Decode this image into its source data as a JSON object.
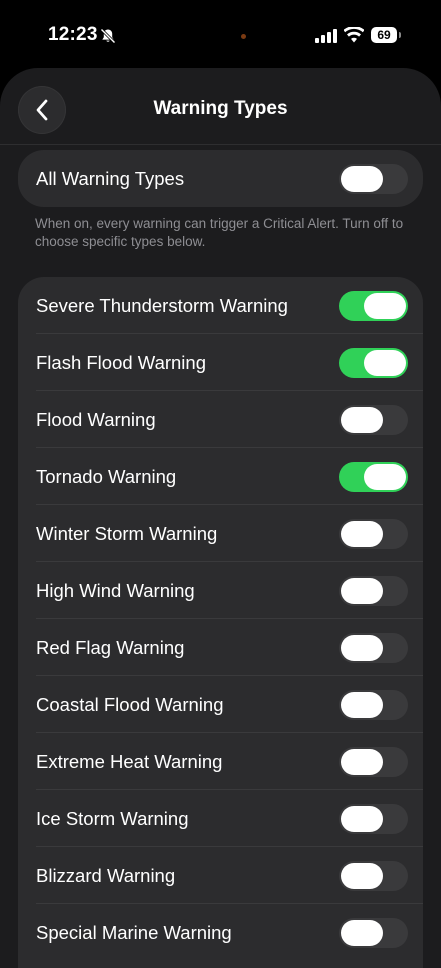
{
  "status_bar": {
    "time": "12:23",
    "battery": "69"
  },
  "header": {
    "title": "Warning Types"
  },
  "all_toggle": {
    "label": "All Warning Types",
    "on": false
  },
  "footnote": "When on, every warning can trigger a Critical Alert. Turn off to choose specific types below.",
  "warnings": [
    {
      "label": "Severe Thunderstorm Warning",
      "on": true
    },
    {
      "label": "Flash Flood Warning",
      "on": true
    },
    {
      "label": "Flood Warning",
      "on": false
    },
    {
      "label": "Tornado Warning",
      "on": true
    },
    {
      "label": "Winter Storm Warning",
      "on": false
    },
    {
      "label": "High Wind Warning",
      "on": false
    },
    {
      "label": "Red Flag Warning",
      "on": false
    },
    {
      "label": "Coastal Flood Warning",
      "on": false
    },
    {
      "label": "Extreme Heat Warning",
      "on": false
    },
    {
      "label": "Ice Storm Warning",
      "on": false
    },
    {
      "label": "Blizzard Warning",
      "on": false
    },
    {
      "label": "Special Marine Warning",
      "on": false
    }
  ],
  "colors": {
    "toggle_on": "#30d158",
    "toggle_off": "#3a3a3c",
    "sheet_bg": "#1c1c1e",
    "group_bg": "#2c2c2e"
  },
  "icons": [
    "bell-slash-icon",
    "cellular-signal-icon",
    "wifi-icon",
    "battery-icon",
    "chevron-left-icon"
  ]
}
